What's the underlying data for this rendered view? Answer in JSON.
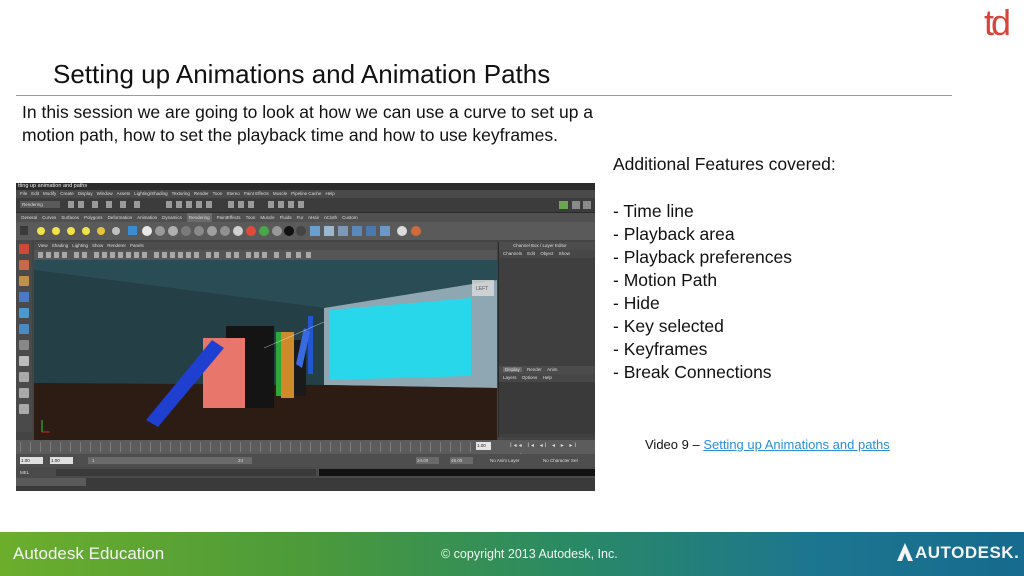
{
  "brand": {
    "td_logo": "td"
  },
  "slide": {
    "title": "Setting up Animations and Animation Paths",
    "intro": "In this session we are going to look at how we can use a curve to set up a motion path, how to set the playback time and how to use keyframes.",
    "features_heading": "Additional Features covered:",
    "features": [
      "- Time line",
      "- Playback area",
      "- Playback preferences",
      "- Motion Path",
      "- Hide",
      "- Key selected",
      "- Keyframes",
      "- Break Connections"
    ],
    "video_prefix": "Video 9 – ",
    "video_link": "Setting up Animations and paths"
  },
  "screenshot": {
    "window_title": "tting up animation and paths",
    "menu": [
      "File",
      "Edit",
      "Modify",
      "Create",
      "Display",
      "Window",
      "Assets",
      "Lighting/Shading",
      "Texturing",
      "Render",
      "Toon",
      "Stereo",
      "Paint Effects",
      "Muscle",
      "Pipeline Cache",
      "Help"
    ],
    "mode": "Rendering",
    "shelf_tabs": [
      "General",
      "Curves",
      "Surfaces",
      "Polygons",
      "Deformation",
      "Animation",
      "Dynamics",
      "Rendering",
      "PaintEffects",
      "Toon",
      "Muscle",
      "Fluids",
      "Fur",
      "nHair",
      "nCloth",
      "Custom"
    ],
    "shelf_active": "Rendering",
    "viewport_menu": [
      "View",
      "Shading",
      "Lighting",
      "Show",
      "Renderer",
      "Panels"
    ],
    "channel_box": {
      "title": "Channel Box / Layer Editor",
      "menu": [
        "Channels",
        "Edit",
        "Object",
        "Show"
      ],
      "layer_tabs": [
        "Display",
        "Render",
        "Anim"
      ],
      "layer_tab_active": "Display",
      "layer_menu": [
        "Layers",
        "Options",
        "Help"
      ]
    },
    "view_cube": "LEFT",
    "timeline": {
      "current_frame": "1.00",
      "start": "1.00",
      "start_inner": "1.00",
      "range_start": "1",
      "range_end": "24",
      "end_inner": "24.00",
      "end": "48.00",
      "anim_layer": "No Anim Layer",
      "character_set": "No Character Set",
      "controls": "I◂◂ I◂ ◂I ◂ ▸ ▸I ▸▸I"
    },
    "command_label": "MEL"
  },
  "footer": {
    "left": "Autodesk Education",
    "center": "© copyright 2013 Autodesk, Inc.",
    "right": "AUTODESK."
  },
  "colors": {
    "td_logo": "#d8433a",
    "link": "#2a8fd6",
    "footer_start": "#6cae2c",
    "footer_end": "#166b8e"
  }
}
